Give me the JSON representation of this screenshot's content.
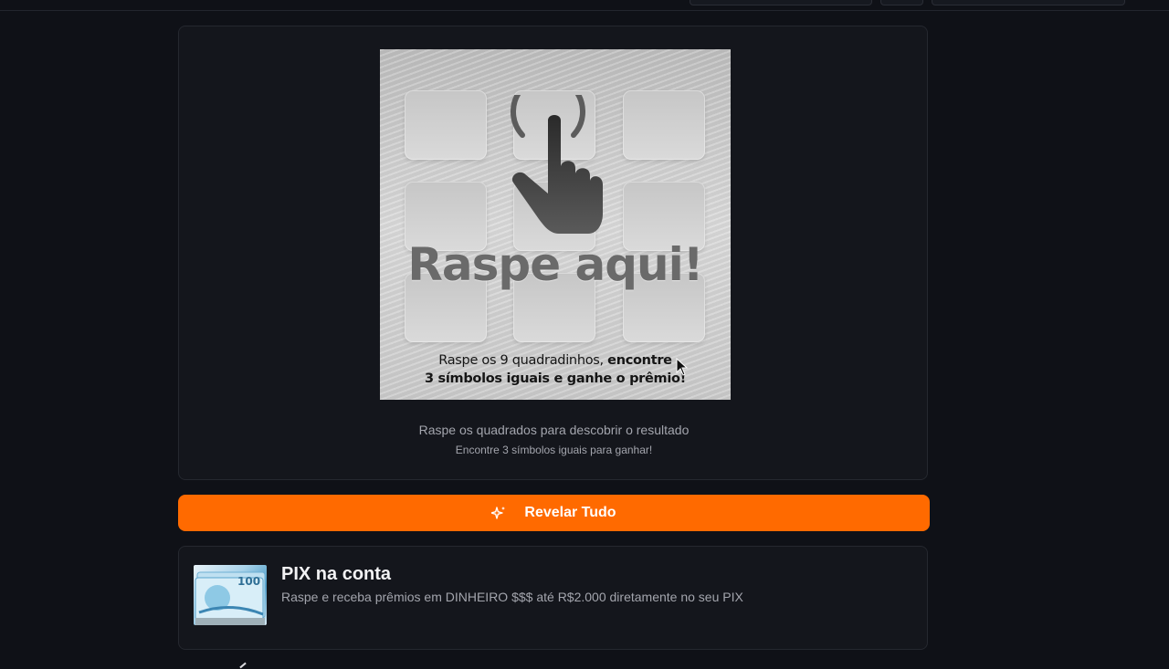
{
  "scratch": {
    "title": "Raspe aqui!",
    "instruction_plain": "Raspe os 9 quadradinhos, ",
    "instruction_bold_1": "encontre",
    "instruction_bold_2": "3 símbolos iguais e ganhe o prêmio!",
    "tiles_count": 9,
    "result_text": "Raspe os quadrados para descobrir o resultado",
    "result_sub": "Encontre 3 símbolos iguais para ganhar!"
  },
  "actions": {
    "reveal_label": "Revelar Tudo",
    "reveal_icon": "sparkles-icon",
    "accent_color": "#ff6a00"
  },
  "prize": {
    "title": "PIX na conta",
    "description": "Raspe e receba prêmios em DINHEIRO $$$ até R$2.000 diretamente no seu PIX",
    "image_icon": "money-bills-icon",
    "image_text": "100"
  },
  "colors": {
    "background": "#0f1117",
    "card": "#14161c",
    "muted_text": "#a3a5ad"
  }
}
